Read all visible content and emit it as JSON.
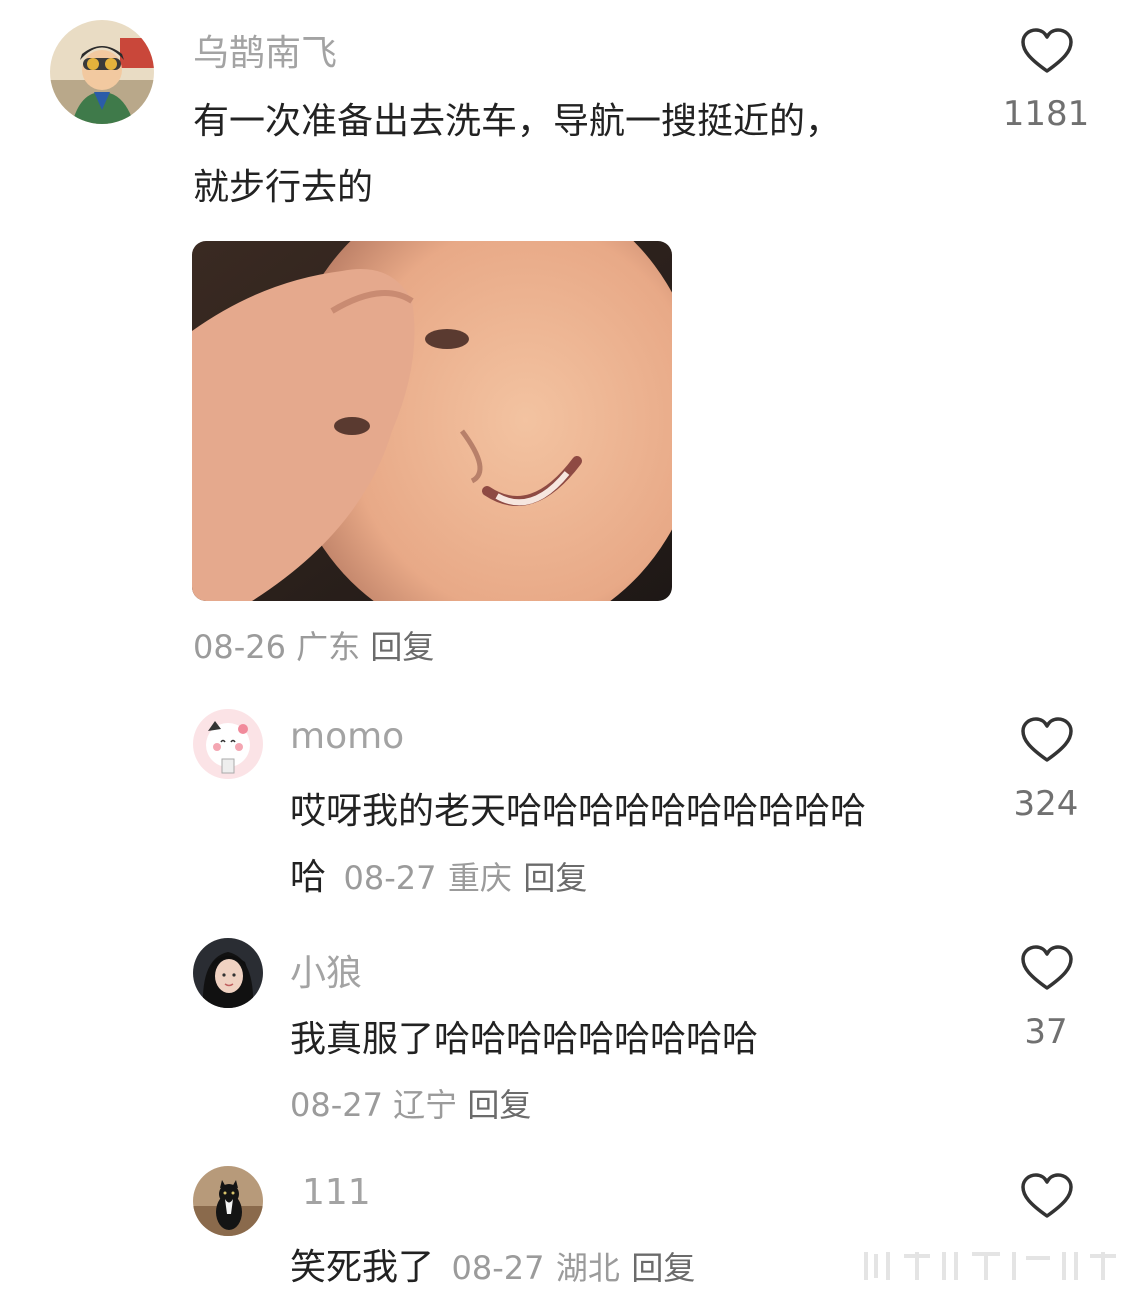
{
  "comments": [
    {
      "username": "乌鹊南飞",
      "text_line1": "有一次准备出去洗车，导航一搜挺近的，",
      "text_line2": "就步行去的",
      "date": "08-26",
      "location": "广东",
      "reply_label": "回复",
      "likes": "1181",
      "has_image": true
    },
    {
      "username": "momo",
      "text_line1": "哎呀我的老天哈哈哈哈哈哈哈哈哈哈",
      "text_line2": "哈",
      "date": "08-27",
      "location": "重庆",
      "reply_label": "回复",
      "likes": "324"
    },
    {
      "username": "小狼",
      "text_line1": "我真服了哈哈哈哈哈哈哈哈哈",
      "date": "08-27",
      "location": "辽宁",
      "reply_label": "回复",
      "likes": "37"
    },
    {
      "username": "111",
      "text_line1": "笑死我了",
      "date": "08-27",
      "location": "湖北",
      "reply_label": "回复"
    }
  ],
  "icons": {
    "like": "heart-outline-icon"
  },
  "colors": {
    "username": "#a3a3a3",
    "body_text": "#222222",
    "meta_text": "#9b9b9b",
    "icon_stroke": "#333333"
  }
}
